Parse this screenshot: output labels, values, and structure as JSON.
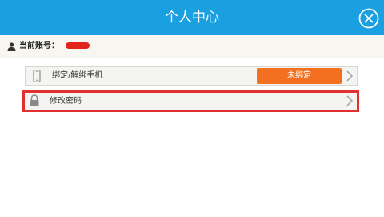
{
  "header": {
    "title": "个人中心",
    "background": "#1a9fe0",
    "close_icon": "close-circle-icon"
  },
  "account": {
    "label": "当前账号：",
    "value_redacted": true,
    "icon": "user-icon"
  },
  "menu": {
    "items": [
      {
        "label": "绑定/解绑手机",
        "icon": "phone-icon",
        "action_label": "未绑定",
        "action_color": "#f2701f",
        "highlighted": false
      },
      {
        "label": "修改密码",
        "icon": "lock-icon",
        "highlighted": true,
        "highlight_color": "#e03030"
      }
    ]
  }
}
